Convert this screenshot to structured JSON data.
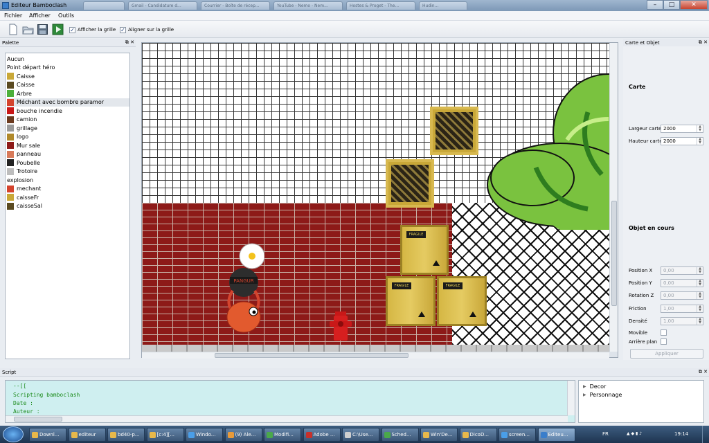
{
  "window": {
    "title": "Editeur Bamboclash"
  },
  "background_tabs": [
    "",
    "Gmail - Candidature d...",
    "Courrier - Boîte de récep...",
    "YouTube - Nemo - Nem...",
    "Hostes & Proget - The...",
    "Hudin..."
  ],
  "menubar": [
    "Fichier",
    "Afficher",
    "Outils"
  ],
  "toolbar": {
    "show_grid_label": "Afficher la grille",
    "align_grid_label": "Aligner sur la grille"
  },
  "palette": {
    "title": "Palette",
    "items": [
      {
        "label": "Aucun",
        "icon": "none"
      },
      {
        "label": "Point départ héro",
        "icon": "none"
      },
      {
        "label": "Caisse",
        "icon": "crate-icon",
        "color": "#c9a838"
      },
      {
        "label": "Caisse",
        "icon": "crate-dark-icon",
        "color": "#5a4a20"
      },
      {
        "label": "Arbre",
        "icon": "tree-icon",
        "color": "#4caf3a"
      },
      {
        "label": "Méchant avec bombre paramor",
        "icon": "enemy-icon",
        "color": "#d4442e"
      },
      {
        "label": "bouche incendie",
        "icon": "hydrant-icon",
        "color": "#c91818"
      },
      {
        "label": "camion",
        "icon": "truck-icon",
        "color": "#6b3a1f"
      },
      {
        "label": "grillage",
        "icon": "fence-icon",
        "color": "#9a9a9a"
      },
      {
        "label": "logo",
        "icon": "logo-icon",
        "color": "#b0892b"
      },
      {
        "label": "Mur sale",
        "icon": "wall-icon",
        "color": "#8d1a18"
      },
      {
        "label": "panneau",
        "icon": "sign-icon",
        "color": "#d77a5a"
      },
      {
        "label": "Poubelle",
        "icon": "trash-icon",
        "color": "#222222"
      },
      {
        "label": "Trotoire",
        "icon": "sidewalk-icon",
        "color": "#bdbdbd"
      },
      {
        "label": "explosion",
        "icon": "none"
      },
      {
        "label": "mechant",
        "icon": "enemy-icon",
        "color": "#d4442e"
      },
      {
        "label": "caisseFr",
        "icon": "crate-fragile-icon",
        "color": "#c9a838"
      },
      {
        "label": "caisseSal",
        "icon": "crate-dirty-icon",
        "color": "#5a4a20"
      }
    ]
  },
  "canvas": {
    "enemy_label": "PANGUR",
    "crate_label": "FRAGILE"
  },
  "map_panel": {
    "title": "Carte et Objet",
    "map_heading": "Carte",
    "width_label": "Largeur carte",
    "width_value": "2000",
    "height_label": "Hauteur carte",
    "height_value": "2000",
    "object_heading": "Objet en cours",
    "fields": [
      {
        "label": "Position X",
        "value": "0,00"
      },
      {
        "label": "Position Y",
        "value": "0,00"
      },
      {
        "label": "Rotation Z",
        "value": "0,00"
      },
      {
        "label": "Friction",
        "value": "1,00"
      },
      {
        "label": "Densité",
        "value": "1,00"
      }
    ],
    "movable_label": "Movible",
    "background_label": "Arrière plan",
    "apply_label": "Appliquer"
  },
  "script": {
    "title": "Script",
    "lines": [
      "--[[",
      "Scripting bamboclash",
      "Date :",
      "Auteur :"
    ]
  },
  "tree": {
    "items": [
      "Decor",
      "Personnage"
    ]
  },
  "taskbar": {
    "tasks": [
      {
        "label": "Downl...",
        "color": "#e8b84a"
      },
      {
        "label": "editeur",
        "color": "#e8b84a"
      },
      {
        "label": "bd40-p...",
        "color": "#e8b84a"
      },
      {
        "label": "[c:4][...",
        "color": "#e8b84a"
      },
      {
        "label": "Windo...",
        "color": "#4a9ee8"
      },
      {
        "label": "(9) Ale...",
        "color": "#e89a3a"
      },
      {
        "label": "Modifi...",
        "color": "#4aa84a"
      },
      {
        "label": "Adobe ...",
        "color": "#c8302a"
      },
      {
        "label": "C:\\Use...",
        "color": "#cfcfcf"
      },
      {
        "label": "Sched...",
        "color": "#4aa84a"
      },
      {
        "label": "Win'De...",
        "color": "#e8b84a"
      },
      {
        "label": "DicoD...",
        "color": "#e8b84a"
      },
      {
        "label": "screen...",
        "color": "#4a9ee8"
      },
      {
        "label": "Editeu...",
        "color": "#3a7ecb"
      }
    ],
    "lang": "FR",
    "time": "19:14"
  }
}
